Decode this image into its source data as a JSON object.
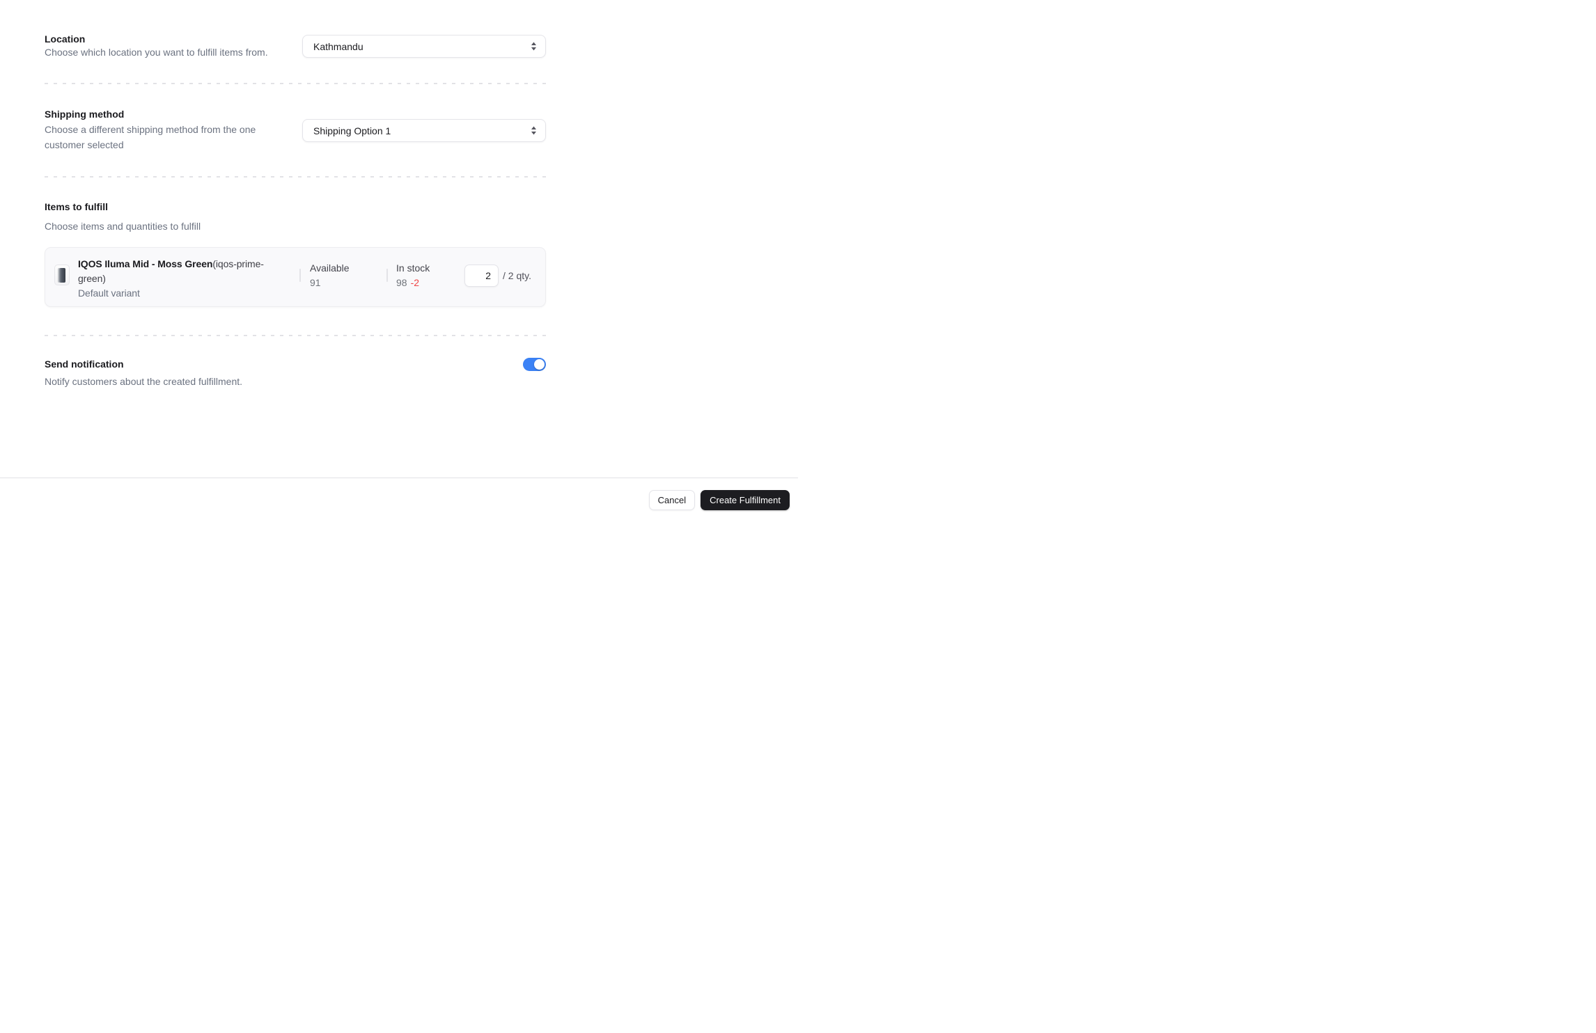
{
  "sections": {
    "location": {
      "title": "Location",
      "description": "Choose which location you want to fulfill items from.",
      "selected": "Kathmandu"
    },
    "shipping": {
      "title": "Shipping method",
      "description": "Choose a different shipping method from the one customer selected",
      "selected": "Shipping Option 1"
    },
    "items": {
      "title": "Items to fulfill",
      "description": "Choose items and quantities to fulfill",
      "item": {
        "name": "IQOS Iluma Mid - Moss Green",
        "sku": "(iqos-prime-green)",
        "variant": "Default variant",
        "available_label": "Available",
        "available_value": "91",
        "in_stock_label": "In stock",
        "in_stock_value": "98",
        "stock_delta": "-2",
        "quantity": "2",
        "quantity_suffix": "/ 2 qty.",
        "thumbnail_icon": "product-device-icon"
      }
    },
    "notification": {
      "title": "Send notification",
      "description": "Notify customers about the created fulfillment.",
      "enabled": true
    }
  },
  "footer": {
    "cancel_label": "Cancel",
    "submit_label": "Create Fulfillment"
  },
  "colors": {
    "accent_toggle_on": "#3b82f6",
    "danger_text": "#ef4444",
    "primary_button_bg": "#1d1d21",
    "card_bg": "#f9f9fb",
    "divider": "#e2e2e6"
  }
}
